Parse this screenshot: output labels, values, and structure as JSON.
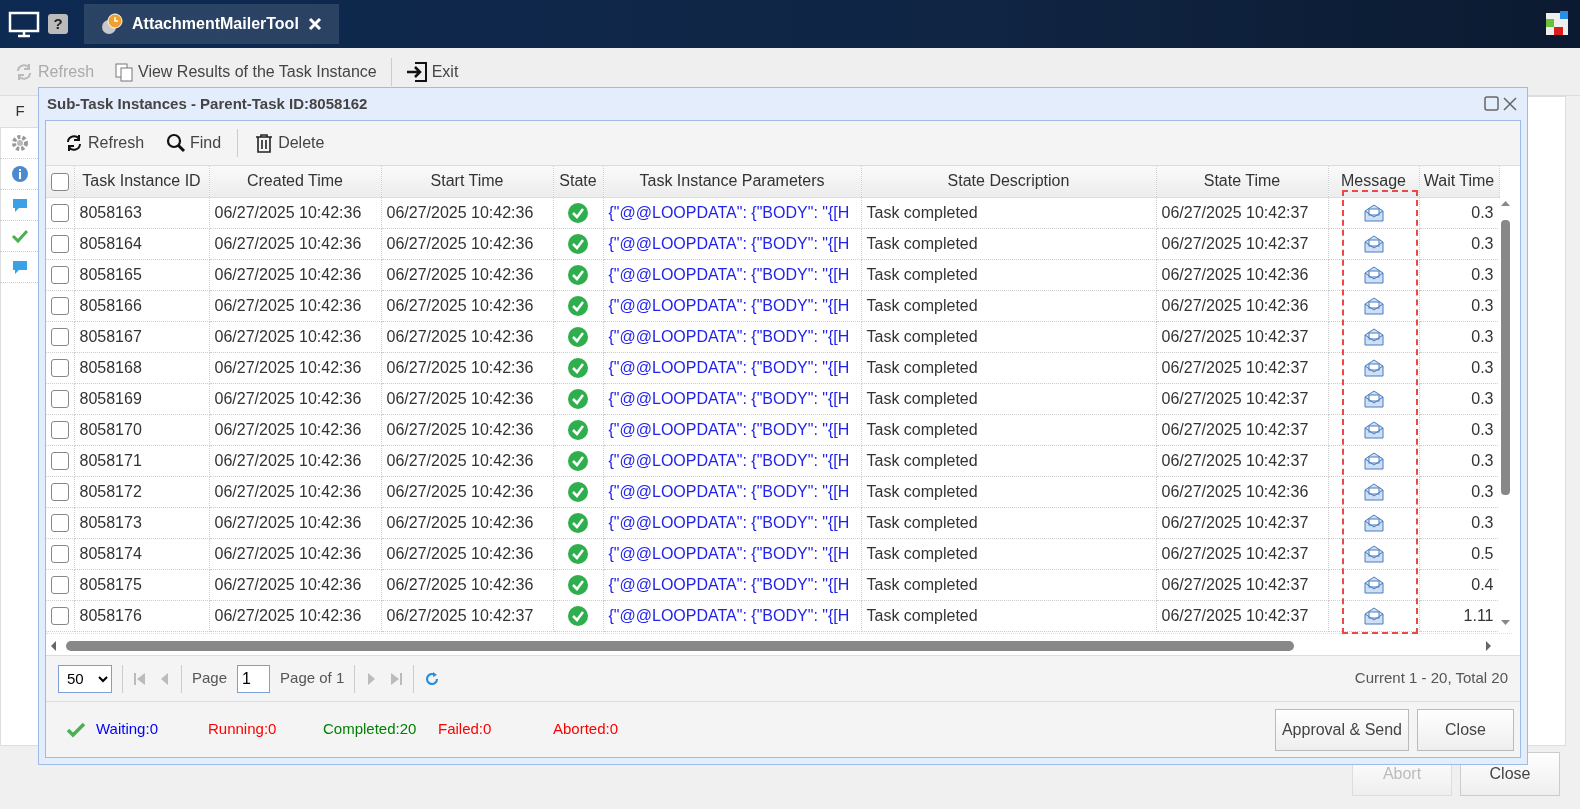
{
  "app": {
    "help_text": "?",
    "tab_title": "AttachmentMailerTool",
    "toolbar": [
      {
        "label": "Refresh",
        "kind": "refresh",
        "disabled": true
      },
      {
        "label": "View Results of the Task Instance",
        "kind": "copy",
        "disabled": false
      },
      {
        "label": "Exit",
        "kind": "exit",
        "disabled": false
      }
    ],
    "panel_header": "F",
    "footer_buttons": [
      {
        "label": "Abort",
        "disabled": true
      },
      {
        "label": "Close",
        "disabled": false
      }
    ]
  },
  "dialog": {
    "title": "Sub-Task Instances - Parent-Task ID:8058162",
    "toolbar": [
      {
        "label": "Refresh",
        "kind": "refresh"
      },
      {
        "label": "Find",
        "kind": "find"
      },
      {
        "label": "Delete",
        "kind": "delete"
      }
    ],
    "select_all_checked": false,
    "columns": [
      "Task Instance ID",
      "Created Time",
      "Start Time",
      "State",
      "Task Instance Parameters",
      "State Description",
      "State Time",
      "Message",
      "Wait Time"
    ],
    "rows": [
      {
        "checked": false,
        "id": "8058163",
        "created": "06/27/2025 10:42:36",
        "start": "06/27/2025 10:42:36",
        "kind": "completed",
        "params": "{\"@@LOOPDATA\": {\"BODY\": \"{[H",
        "description": "Task completed",
        "state_time": "06/27/2025 10:42:37",
        "wait": "0.3"
      },
      {
        "checked": false,
        "id": "8058164",
        "created": "06/27/2025 10:42:36",
        "start": "06/27/2025 10:42:36",
        "kind": "completed",
        "params": "{\"@@LOOPDATA\": {\"BODY\": \"{[H",
        "description": "Task completed",
        "state_time": "06/27/2025 10:42:37",
        "wait": "0.3"
      },
      {
        "checked": false,
        "id": "8058165",
        "created": "06/27/2025 10:42:36",
        "start": "06/27/2025 10:42:36",
        "kind": "completed",
        "params": "{\"@@LOOPDATA\": {\"BODY\": \"{[H",
        "description": "Task completed",
        "state_time": "06/27/2025 10:42:36",
        "wait": "0.3"
      },
      {
        "checked": false,
        "id": "8058166",
        "created": "06/27/2025 10:42:36",
        "start": "06/27/2025 10:42:36",
        "kind": "completed",
        "params": "{\"@@LOOPDATA\": {\"BODY\": \"{[H",
        "description": "Task completed",
        "state_time": "06/27/2025 10:42:36",
        "wait": "0.3"
      },
      {
        "checked": false,
        "id": "8058167",
        "created": "06/27/2025 10:42:36",
        "start": "06/27/2025 10:42:36",
        "kind": "completed",
        "params": "{\"@@LOOPDATA\": {\"BODY\": \"{[H",
        "description": "Task completed",
        "state_time": "06/27/2025 10:42:37",
        "wait": "0.3"
      },
      {
        "checked": false,
        "id": "8058168",
        "created": "06/27/2025 10:42:36",
        "start": "06/27/2025 10:42:36",
        "kind": "completed",
        "params": "{\"@@LOOPDATA\": {\"BODY\": \"{[H",
        "description": "Task completed",
        "state_time": "06/27/2025 10:42:37",
        "wait": "0.3"
      },
      {
        "checked": false,
        "id": "8058169",
        "created": "06/27/2025 10:42:36",
        "start": "06/27/2025 10:42:36",
        "kind": "completed",
        "params": "{\"@@LOOPDATA\": {\"BODY\": \"{[H",
        "description": "Task completed",
        "state_time": "06/27/2025 10:42:37",
        "wait": "0.3"
      },
      {
        "checked": false,
        "id": "8058170",
        "created": "06/27/2025 10:42:36",
        "start": "06/27/2025 10:42:36",
        "kind": "completed",
        "params": "{\"@@LOOPDATA\": {\"BODY\": \"{[H",
        "description": "Task completed",
        "state_time": "06/27/2025 10:42:37",
        "wait": "0.3"
      },
      {
        "checked": false,
        "id": "8058171",
        "created": "06/27/2025 10:42:36",
        "start": "06/27/2025 10:42:36",
        "kind": "completed",
        "params": "{\"@@LOOPDATA\": {\"BODY\": \"{[H",
        "description": "Task completed",
        "state_time": "06/27/2025 10:42:37",
        "wait": "0.3"
      },
      {
        "checked": false,
        "id": "8058172",
        "created": "06/27/2025 10:42:36",
        "start": "06/27/2025 10:42:36",
        "kind": "completed",
        "params": "{\"@@LOOPDATA\": {\"BODY\": \"{[H",
        "description": "Task completed",
        "state_time": "06/27/2025 10:42:36",
        "wait": "0.3"
      },
      {
        "checked": false,
        "id": "8058173",
        "created": "06/27/2025 10:42:36",
        "start": "06/27/2025 10:42:36",
        "kind": "completed",
        "params": "{\"@@LOOPDATA\": {\"BODY\": \"{[H",
        "description": "Task completed",
        "state_time": "06/27/2025 10:42:37",
        "wait": "0.3"
      },
      {
        "checked": false,
        "id": "8058174",
        "created": "06/27/2025 10:42:36",
        "start": "06/27/2025 10:42:36",
        "kind": "completed",
        "params": "{\"@@LOOPDATA\": {\"BODY\": \"{[H",
        "description": "Task completed",
        "state_time": "06/27/2025 10:42:37",
        "wait": "0.5"
      },
      {
        "checked": false,
        "id": "8058175",
        "created": "06/27/2025 10:42:36",
        "start": "06/27/2025 10:42:36",
        "kind": "completed",
        "params": "{\"@@LOOPDATA\": {\"BODY\": \"{[H",
        "description": "Task completed",
        "state_time": "06/27/2025 10:42:37",
        "wait": "0.4"
      },
      {
        "checked": false,
        "id": "8058176",
        "created": "06/27/2025 10:42:36",
        "start": "06/27/2025 10:42:37",
        "kind": "completed",
        "params": "{\"@@LOOPDATA\": {\"BODY\": \"{[H",
        "description": "Task completed",
        "state_time": "06/27/2025 10:42:37",
        "wait": "1.11"
      }
    ],
    "pager": {
      "page_size": "50",
      "page_label": "Page",
      "page": "1",
      "page_of": "Page of 1",
      "summary": "Current 1 - 20, Total 20"
    },
    "status": [
      {
        "label": "Waiting:0",
        "color": "#0000ff"
      },
      {
        "label": "Running:0",
        "color": "#ff0000"
      },
      {
        "label": "Completed:20",
        "color": "#008000"
      },
      {
        "label": "Failed:0",
        "color": "#ff0000"
      },
      {
        "label": "Aborted:0",
        "color": "#ff0000"
      }
    ],
    "buttons": [
      "Approval & Send",
      "Close"
    ]
  }
}
